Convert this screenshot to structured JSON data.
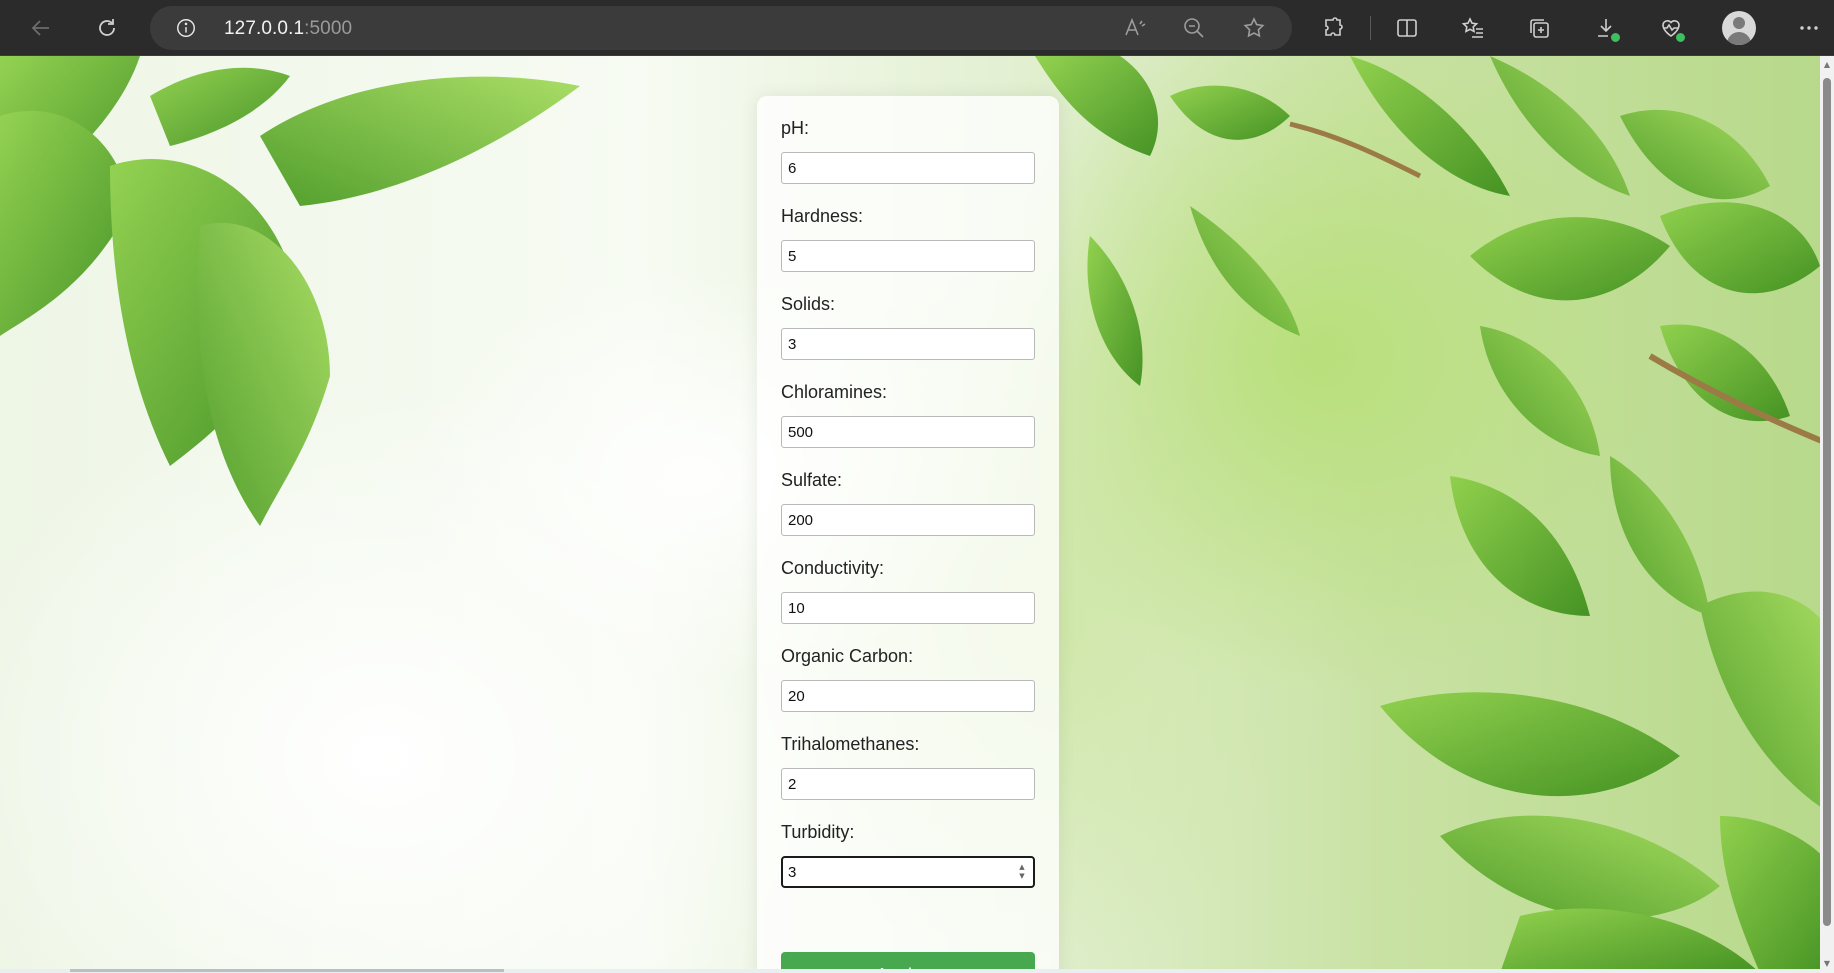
{
  "browser": {
    "url_host": "127.0.0.1",
    "url_port": ":5000",
    "icons": {
      "back": "back-arrow-icon",
      "refresh": "refresh-icon",
      "site_info": "info-icon",
      "read_aloud": "read-aloud-icon",
      "zoom": "zoom-out-icon",
      "favorite": "star-icon",
      "extensions": "puzzle-icon",
      "split_screen": "split-screen-icon",
      "favorites": "favorites-list-icon",
      "collections": "collections-icon",
      "downloads": "download-icon",
      "browser_essentials": "heart-pulse-icon",
      "profile": "profile-avatar-icon",
      "menu": "more-menu-icon"
    }
  },
  "form": {
    "fields": [
      {
        "label": "pH:",
        "value": "6"
      },
      {
        "label": "Hardness:",
        "value": "5"
      },
      {
        "label": "Solids:",
        "value": "3"
      },
      {
        "label": "Chloramines:",
        "value": "500"
      },
      {
        "label": "Sulfate:",
        "value": "200"
      },
      {
        "label": "Conductivity:",
        "value": "10"
      },
      {
        "label": "Organic Carbon:",
        "value": "20"
      },
      {
        "label": "Trihalomethanes:",
        "value": "2"
      },
      {
        "label": "Turbidity:",
        "value": "3"
      }
    ],
    "submit_label": "Analyze"
  },
  "colors": {
    "button": "#48a84f",
    "leaf": "#5fae2e",
    "toolbar": "#2b2b2b"
  }
}
